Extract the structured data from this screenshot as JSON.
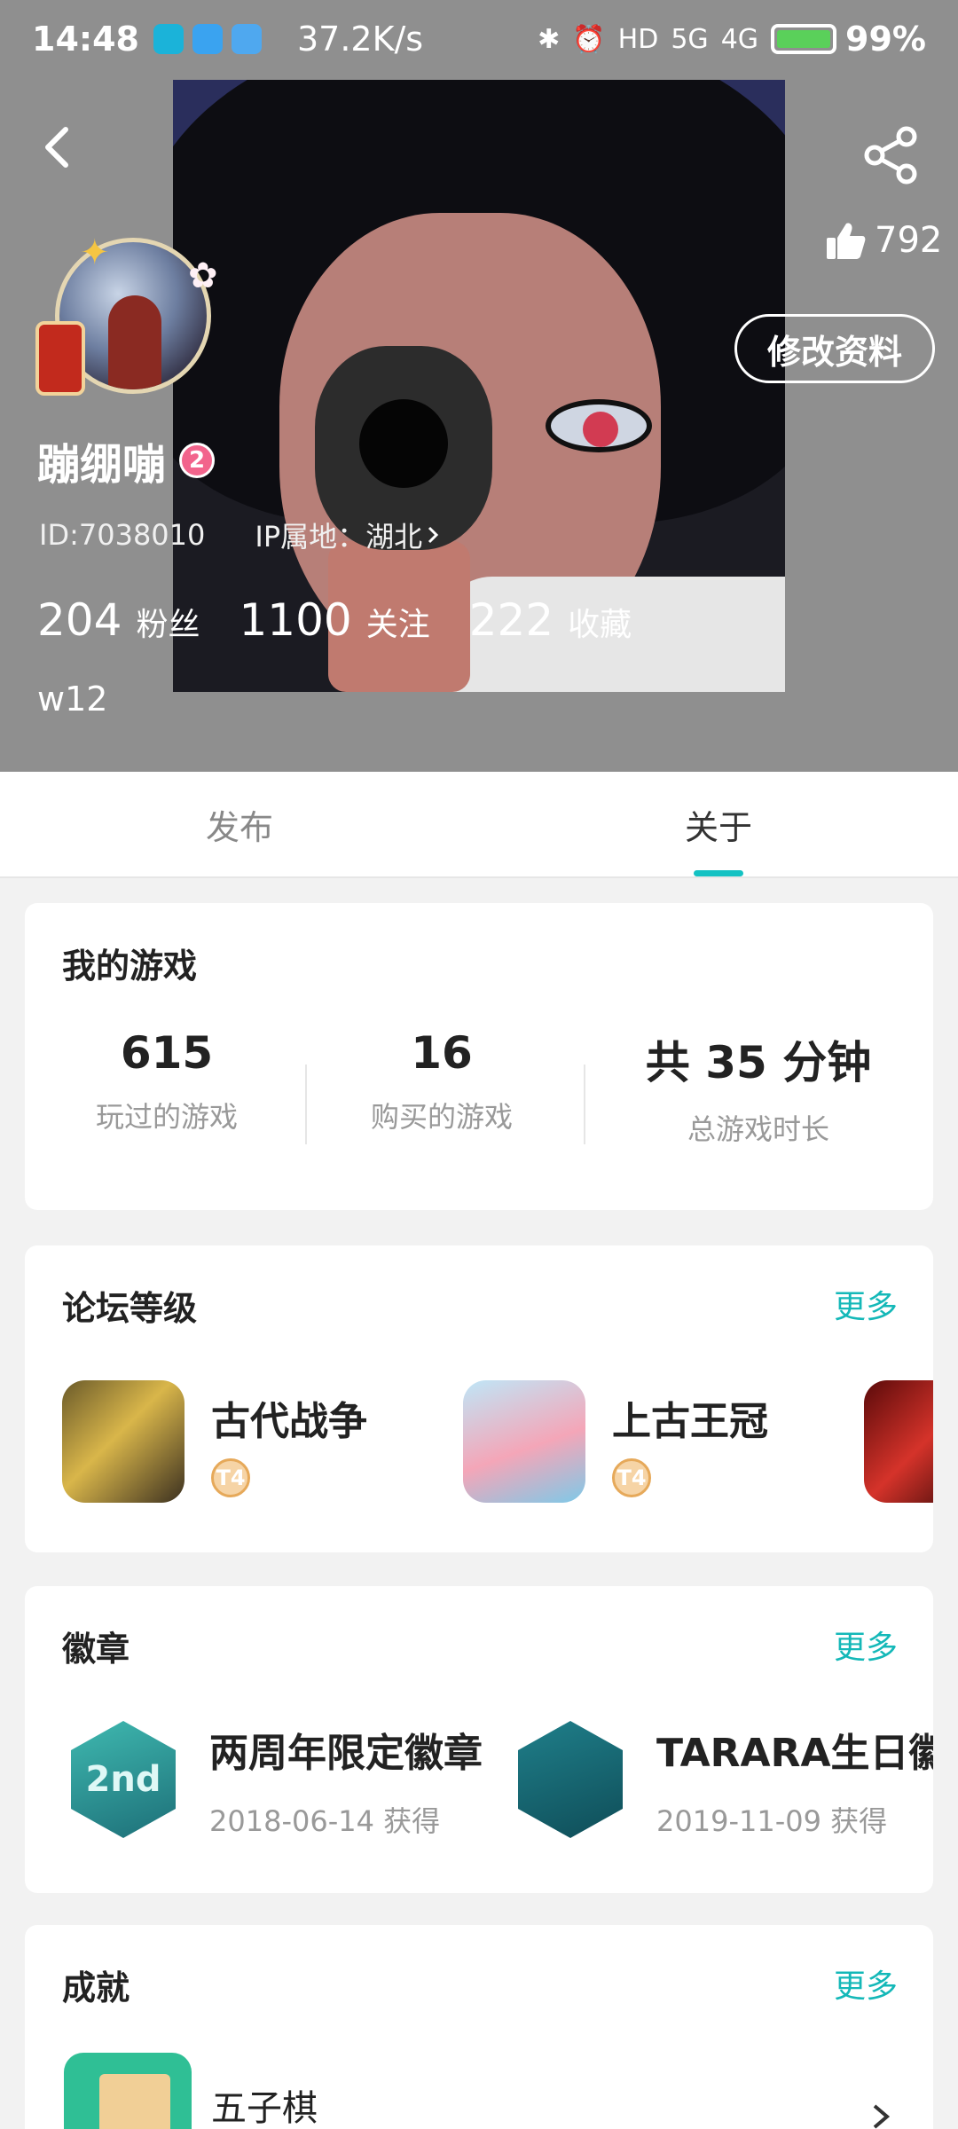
{
  "status_bar": {
    "time": "14:48",
    "speed": "37.2K/s",
    "signal_5g": "5G",
    "signal_4g": "4G",
    "hd": "HD",
    "battery": "99%"
  },
  "header": {
    "likes": "792",
    "edit_label": "修改资料",
    "username": "蹦绷嘣",
    "level": "2",
    "id_text": "ID:7038010",
    "ip_text": "IP属地：湖北",
    "stats": [
      {
        "value": "204",
        "label": "粉丝"
      },
      {
        "value": "1100",
        "label": "关注"
      },
      {
        "value": "222",
        "label": "收藏"
      }
    ],
    "bio": "w12"
  },
  "tabs": [
    {
      "label": "发布",
      "active": false
    },
    {
      "label": "关于",
      "active": true
    }
  ],
  "games_card": {
    "title": "我的游戏",
    "stats": [
      {
        "value": "615",
        "label": "玩过的游戏"
      },
      {
        "value": "16",
        "label": "购买的游戏"
      },
      {
        "value": "共 35 分钟",
        "label": "总游戏时长"
      }
    ]
  },
  "forum_card": {
    "title": "论坛等级",
    "more": "更多",
    "items": [
      {
        "name": "古代战争",
        "level": "T4"
      },
      {
        "name": "上古王冠",
        "level": "T4"
      }
    ]
  },
  "badge_card": {
    "title": "徽章",
    "more": "更多",
    "items": [
      {
        "name": "两周年限定徽章",
        "date": "2018-06-14 获得",
        "icon_text": "2nd"
      },
      {
        "name": "TARARA生日徽章",
        "date": "2019-11-09 获得",
        "icon_text": ""
      }
    ]
  },
  "achievement_card": {
    "title": "成就",
    "more": "更多",
    "item_name": "五子棋"
  },
  "colors": {
    "accent": "#14c2c3",
    "header_bg": "#8f8f8f"
  }
}
